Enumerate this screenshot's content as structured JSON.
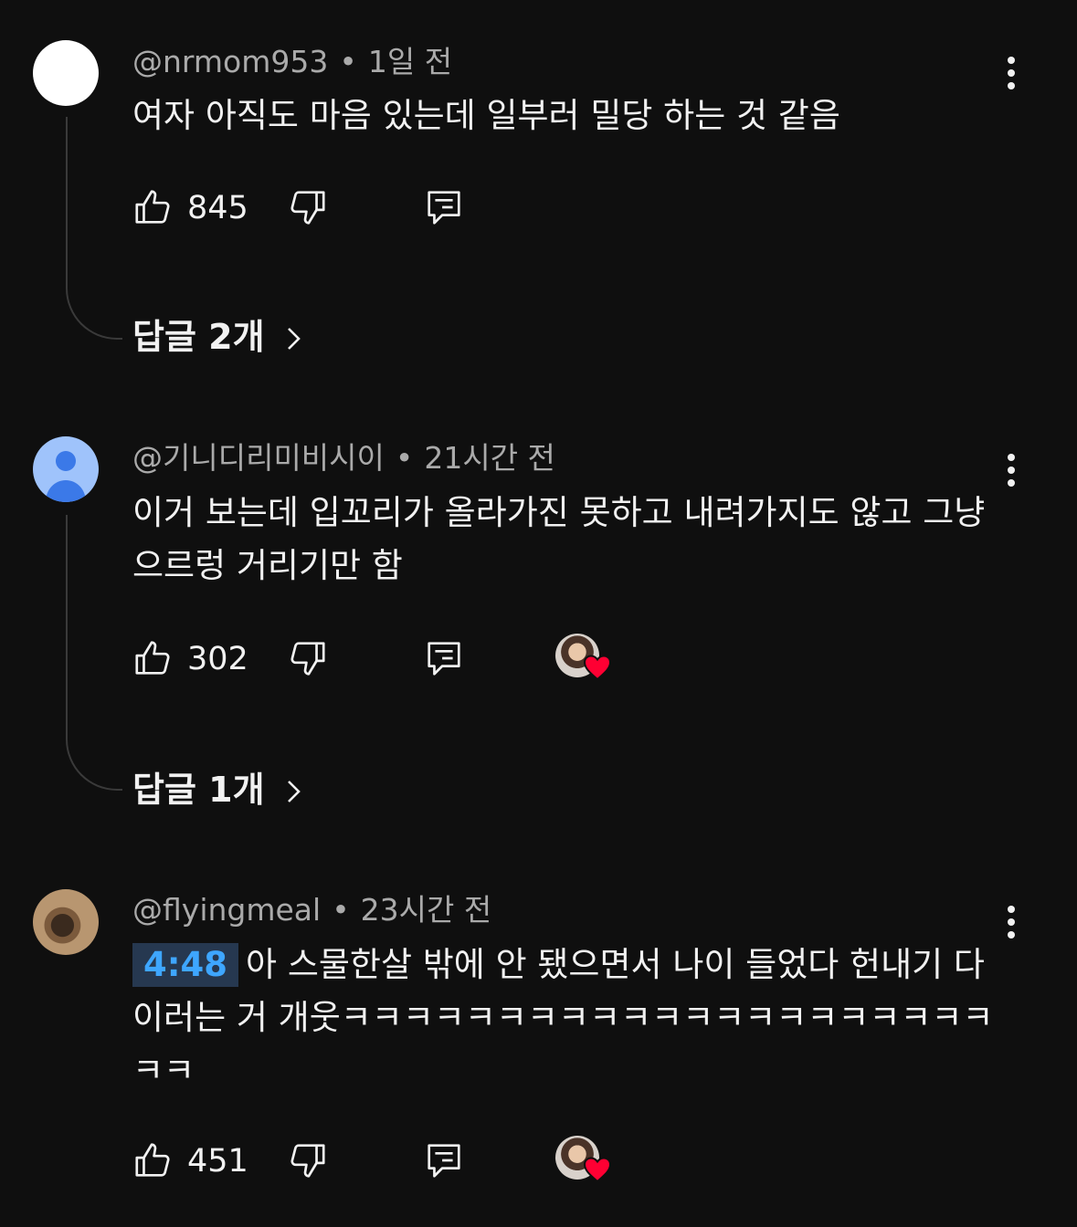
{
  "comments": [
    {
      "author": "@nrmom953",
      "time": "1일 전",
      "text": "여자 아직도 마음 있는데 일부러 밀당 하는 것 같음",
      "timestamp_link": "",
      "likes": "845",
      "replies_label": "답글 2개",
      "creator_heart": false
    },
    {
      "author": "@기니디리미비시이",
      "time": "21시간 전",
      "text": "이거 보는데 입꼬리가 올라가진 못하고 내려가지도 않고 그냥 으르렁 거리기만 함",
      "timestamp_link": "",
      "likes": "302",
      "replies_label": "답글 1개",
      "creator_heart": true
    },
    {
      "author": "@flyingmeal",
      "time": "23시간 전",
      "timestamp_link": "4:48",
      "text": "아 스물한살 밖에 안 됐으면서 나이 들었다 헌내기 다 이러는 거 개웃ㅋㅋㅋㅋㅋㅋㅋㅋㅋㅋㅋㅋㅋㅋㅋㅋㅋㅋㅋㅋㅋㅋㅋ",
      "likes": "451",
      "creator_heart": true
    }
  ],
  "meta_separator": "•",
  "colors": {
    "background": "#0f0f0f",
    "text": "#f1f1f1",
    "meta": "#aaaaaa",
    "timestamp_link": "#3ea6ff",
    "heart": "#ff0033"
  }
}
